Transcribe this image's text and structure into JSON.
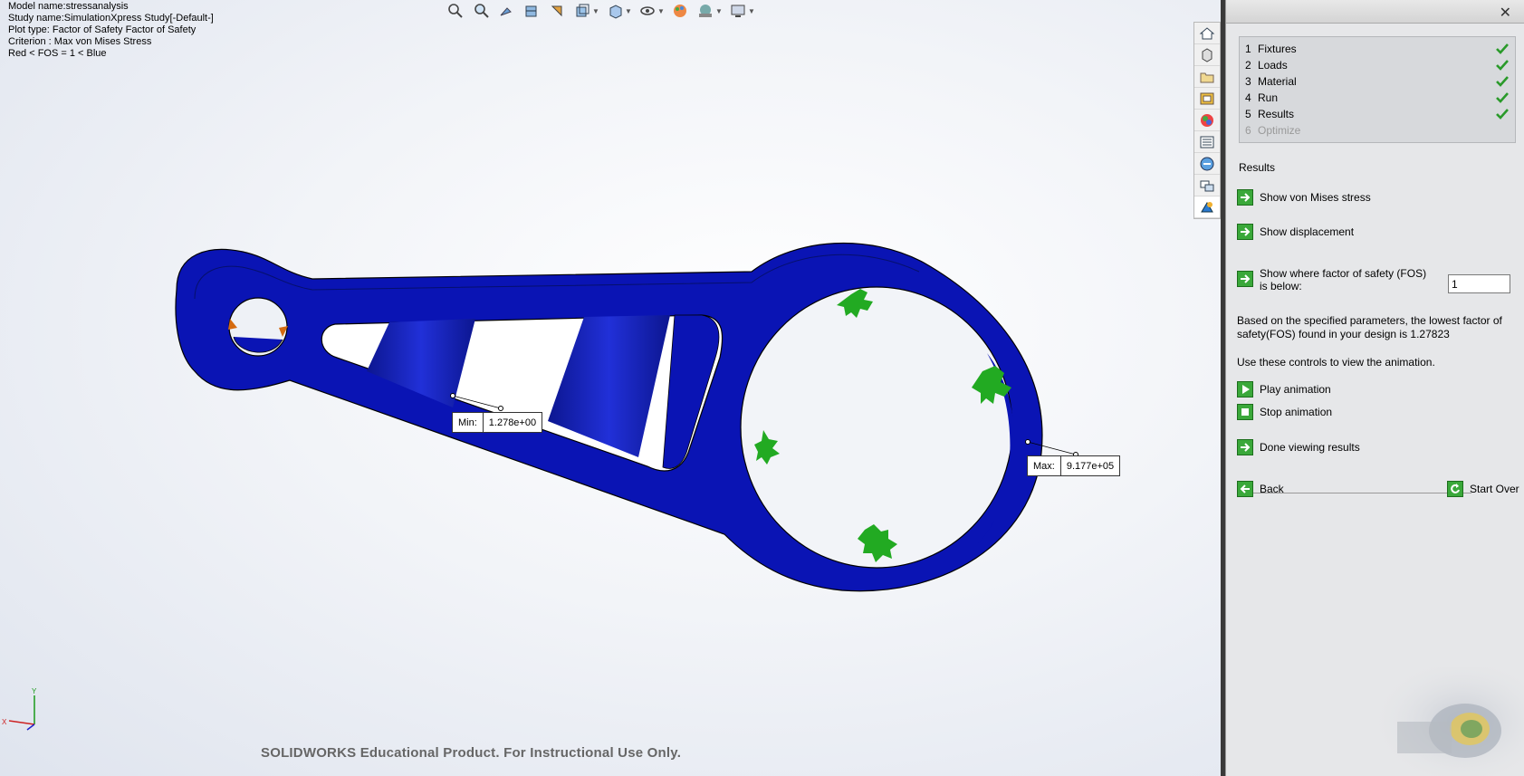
{
  "info": {
    "model": "Model name:stressanalysis",
    "study": "Study name:SimulationXpress Study[-Default-]",
    "plot": "Plot type: Factor of Safety Factor of Safety",
    "criterion": "Criterion : Max von Mises Stress",
    "legend": "Red <  FOS = 1 < Blue"
  },
  "hud_icons": [
    "zoom-to-fit-icon",
    "zoom-to-area-icon",
    "previous-view-icon",
    "section-view-icon",
    "view-orientation-icon",
    "display-style-icon",
    "view-orientation-cube-icon",
    "hide-show-items-icon",
    "edit-appearance-icon",
    "apply-scene-icon",
    "view-settings-icon"
  ],
  "probes": {
    "min_label": "Min:",
    "min_value": "1.278e+00",
    "max_label": "Max:",
    "max_value": "9.177e+05"
  },
  "watermark": "SOLIDWORKS Educational Product. For Instructional Use Only.",
  "taskpane_icons": [
    "home-icon",
    "3d-parts-icon",
    "file-explorer-icon",
    "view-palette-icon",
    "appearances-icon",
    "custom-properties-icon",
    "solidworks-forum-icon",
    "simulationxpress-icon"
  ],
  "panel": {
    "close": "✕",
    "steps": [
      {
        "num": "1",
        "label": "Fixtures",
        "done": true
      },
      {
        "num": "2",
        "label": "Loads",
        "done": true
      },
      {
        "num": "3",
        "label": "Material",
        "done": true
      },
      {
        "num": "4",
        "label": "Run",
        "done": true
      },
      {
        "num": "5",
        "label": "Results",
        "done": true
      },
      {
        "num": "6",
        "label": "Optimize",
        "done": false
      }
    ],
    "section_title": "Results",
    "show_vm": "Show von Mises stress",
    "show_disp": "Show displacement",
    "fos_label": "Show where factor of safety (FOS) is below:",
    "fos_value": "1",
    "summary": "Based on the specified parameters, the lowest factor of safety(FOS) found in your design is 1.27823",
    "anim_hint": "Use these controls to view the animation.",
    "play": "Play animation",
    "stop": "Stop animation",
    "done": "Done viewing results",
    "back": "Back",
    "start_over": "Start Over"
  },
  "colors": {
    "part_blue": "#0a14b4",
    "fixture_green": "#22aa22",
    "load_orange": "#d46a10",
    "action_green": "#3aa83a"
  }
}
